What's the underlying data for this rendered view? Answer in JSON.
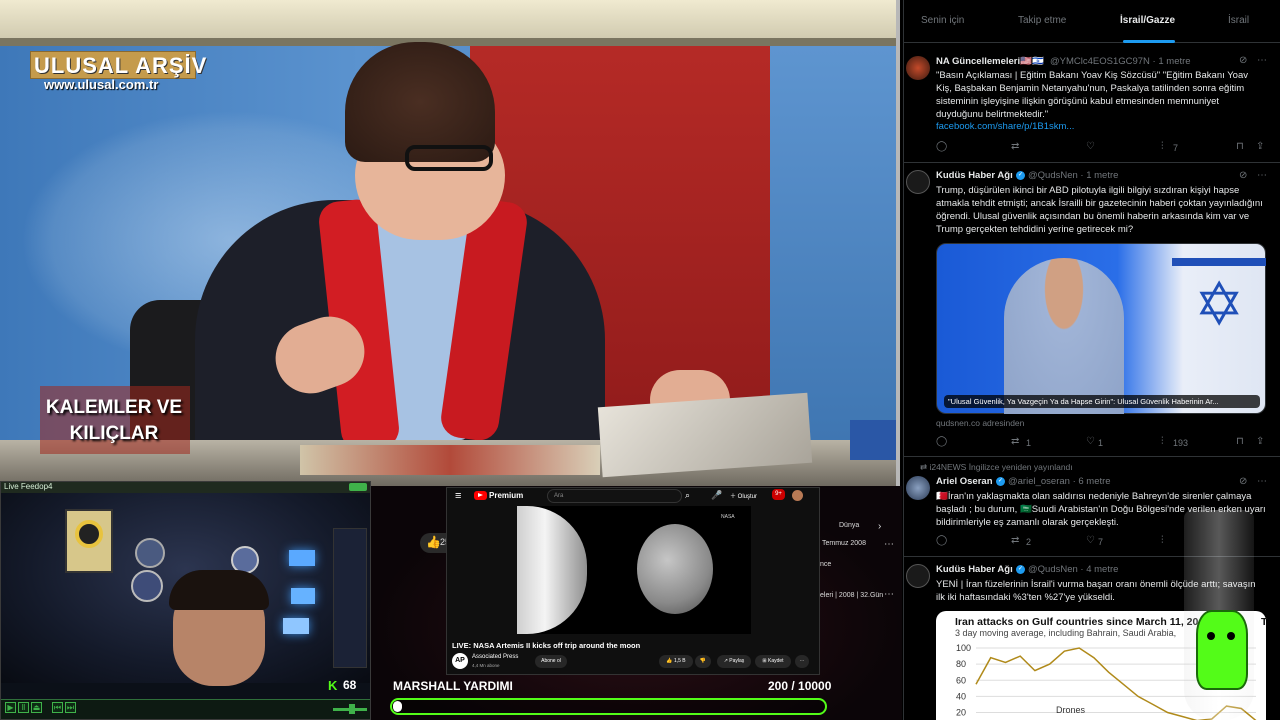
{
  "tv": {
    "logo": "ULUSAL ARŞİV",
    "url": "www.ulusal.com.tr",
    "program_line1": "KALEMLER VE",
    "program_line2": "KILIÇLAR"
  },
  "webcam": {
    "title": "Live Feedop4",
    "viewer_count": "68",
    "kick_logo": "K"
  },
  "middle": {
    "like_count": "25",
    "side_text_1": "Temmuz 2008",
    "side_text_2": "nce",
    "side_text_3": "eleri | 2008 | 32.Gün",
    "side_tab": "Dünya"
  },
  "youtube": {
    "brand": "Premium",
    "search_placeholder": "Ara",
    "create_label": "Oluştur",
    "notif_count": "9+",
    "video_overlay": "NASA",
    "video_title": "LIVE: NASA Artemis II kicks off trip around the moon",
    "channel_avatar": "AP",
    "channel_name": "Associated Press",
    "channel_subs": "4,4 Mn abone",
    "subscribe_label": "Abone ol",
    "like_count": "1,5 B",
    "share_label": "Paylaş",
    "save_label": "Kaydet"
  },
  "goal": {
    "label": "MARSHALL YARDIMI",
    "count_text": "200 / 10000",
    "current": 200,
    "target": 10000,
    "accent": "#53fc18"
  },
  "twitter": {
    "tabs": [
      "Senin için",
      "Takip etme",
      "İsrail/Gazze",
      "İsrail"
    ],
    "active_tab": 2,
    "tweets": [
      {
        "name": "NA Güncellemeleri🇺🇸🇮🇱",
        "handle": "@YMClc4EOS1GC97N · 1 metre",
        "text": "\"Basın Açıklaması | Eğitim Bakanı Yoav Kiş Sözcüsü\" \"Eğitim Bakanı Yoav Kiş, Başbakan Benjamin Netanyahu'nun, Paskalya tatilinden sonra eğitim sisteminin işleyişine ilişkin görüşünü kabul etmesinden memnuniyet duyduğunu belirtmektedir.\"",
        "link": "facebook.com/share/p/1B1skm...",
        "views": "7"
      },
      {
        "name": "Kudüs Haber Ağı",
        "handle": "@QudsNen · 1 metre",
        "text": "Trump, düşürülen ikinci bir ABD pilotuyla ilgili bilgiyi sızdıran kişiyi hapse atmakla tehdit etmişti; ancak İsrailli bir gazetecinin haberi çoktan yayınladığını öğrendi. Ulusal güvenlik açısından bu önemli haberin arkasında kim var ve Trump gerçekten tehdidini yerine getirecek mi?",
        "image_caption": "\"Ulusal Güvenlik, Ya Vazgeçin Ya da Hapse Girin\": Ulusal Güvenlik Haberinin Ar...",
        "source": "qudsnen.co adresinden",
        "retweets": "1",
        "likes": "1",
        "views": "193"
      },
      {
        "retweet_line": "i24NEWS İngilizce yeniden yayınlandı",
        "name": "Ariel Oseran",
        "handle": "@ariel_oseran · 6 metre",
        "text": "🇧🇭İran'ın yaklaşmakta olan saldırısı nedeniyle Bahreyn'de sirenler çalmaya başladı ; bu durum, 🇸🇦Suudi Arabistan'ın Doğu Bölgesi'nde verilen erken uyarı bildirimleriyle eş zamanlı olarak gerçekleşti.",
        "retweets": "2",
        "likes": "7"
      },
      {
        "name": "Kudüs Haber Ağı",
        "handle": "@QudsNen · 4 metre",
        "text": "YENİ | İran füzelerinin İsrail'i vurma başarı oranı önemli ölçüde arttı; savaşın ilk iki haftasındaki %3'ten %27'ye yükseldi.",
        "chart_title": "Iran attacks on Gulf countries since March 11, 20",
        "chart_title_tail": "T",
        "chart_subtitle": "3 day moving average, including Bahrain, Saudi Arabia,"
      }
    ]
  },
  "chart_data": {
    "type": "line",
    "title": "Iran attacks on Gulf countries since March 11, 20",
    "subtitle": "3 day moving average, including Bahrain, Saudi Arabia,",
    "yticks": [
      "100",
      "80",
      "60",
      "40",
      "20"
    ],
    "ylim": [
      0,
      100
    ],
    "series": [
      {
        "name": "Drones",
        "x": [
          0,
          1,
          2,
          3,
          4,
          5,
          6,
          7,
          8,
          9,
          10,
          11,
          12,
          13,
          14,
          15,
          16,
          17,
          18,
          19
        ],
        "values": [
          55,
          88,
          82,
          90,
          72,
          80,
          96,
          100,
          88,
          70,
          55,
          40,
          30,
          20,
          15,
          10,
          12,
          28,
          25,
          10
        ]
      }
    ]
  }
}
